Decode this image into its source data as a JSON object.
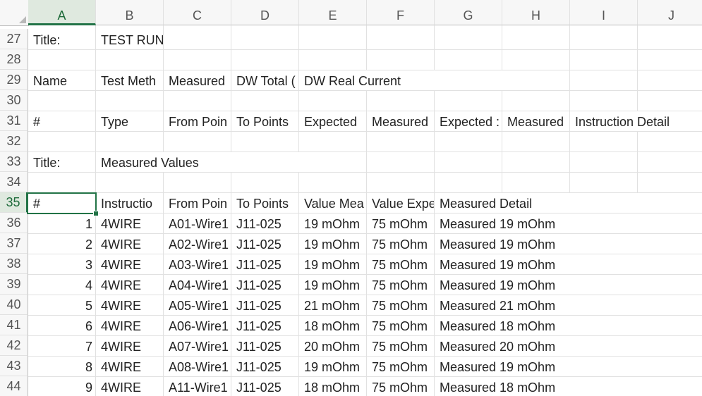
{
  "columns": [
    "A",
    "B",
    "C",
    "D",
    "E",
    "F",
    "G",
    "H",
    "I",
    "J"
  ],
  "selected_column": "A",
  "selected_row": "35",
  "rows": [
    {
      "num": "27",
      "cells": [
        "Title:",
        "TEST RUN",
        "",
        "",
        "",
        "",
        "",
        "",
        "",
        ""
      ]
    },
    {
      "num": "28",
      "cells": [
        "",
        "",
        "",
        "",
        "",
        "",
        "",
        "",
        "",
        ""
      ]
    },
    {
      "num": "29",
      "cells": [
        "Name",
        "Test Meth",
        "Measured",
        "DW Total (",
        "DW Real Current",
        "",
        "",
        "",
        "",
        ""
      ]
    },
    {
      "num": "30",
      "cells": [
        "",
        "",
        "",
        "",
        "",
        "",
        "",
        "",
        "",
        ""
      ]
    },
    {
      "num": "31",
      "cells": [
        "#",
        "Type",
        "From Poin",
        "To Points",
        "Expected",
        "Measured",
        "Expected :",
        "Measured",
        "Instruction Detail",
        ""
      ]
    },
    {
      "num": "32",
      "cells": [
        "",
        "",
        "",
        "",
        "",
        "",
        "",
        "",
        "",
        ""
      ]
    },
    {
      "num": "33",
      "cells": [
        "Title:",
        "Measured Values",
        "",
        "",
        "",
        "",
        "",
        "",
        "",
        ""
      ]
    },
    {
      "num": "34",
      "cells": [
        "",
        "",
        "",
        "",
        "",
        "",
        "",
        "",
        "",
        ""
      ]
    },
    {
      "num": "35",
      "cells": [
        "#",
        "Instructio",
        "From Poin",
        "To Points",
        "Value Mea",
        "Value Expe",
        "Measured Detail",
        "",
        "",
        ""
      ]
    },
    {
      "num": "36",
      "cells": [
        "1",
        "4WIRE",
        "A01-Wire1",
        "J11-025",
        "19 mOhm",
        "75 mOhm",
        "Measured 19 mOhm",
        "",
        "",
        ""
      ]
    },
    {
      "num": "37",
      "cells": [
        "2",
        "4WIRE",
        "A02-Wire1",
        "J11-025",
        "19 mOhm",
        "75 mOhm",
        "Measured 19 mOhm",
        "",
        "",
        ""
      ]
    },
    {
      "num": "38",
      "cells": [
        "3",
        "4WIRE",
        "A03-Wire1",
        "J11-025",
        "19 mOhm",
        "75 mOhm",
        "Measured 19 mOhm",
        "",
        "",
        ""
      ]
    },
    {
      "num": "39",
      "cells": [
        "4",
        "4WIRE",
        "A04-Wire1",
        "J11-025",
        "19 mOhm",
        "75 mOhm",
        "Measured 19 mOhm",
        "",
        "",
        ""
      ]
    },
    {
      "num": "40",
      "cells": [
        "5",
        "4WIRE",
        "A05-Wire1",
        "J11-025",
        "21 mOhm",
        "75 mOhm",
        "Measured 21 mOhm",
        "",
        "",
        ""
      ]
    },
    {
      "num": "41",
      "cells": [
        "6",
        "4WIRE",
        "A06-Wire1",
        "J11-025",
        "18 mOhm",
        "75 mOhm",
        "Measured 18 mOhm",
        "",
        "",
        ""
      ]
    },
    {
      "num": "42",
      "cells": [
        "7",
        "4WIRE",
        "A07-Wire1",
        "J11-025",
        "20 mOhm",
        "75 mOhm",
        "Measured 20 mOhm",
        "",
        "",
        ""
      ]
    },
    {
      "num": "43",
      "cells": [
        "8",
        "4WIRE",
        "A08-Wire1",
        "J11-025",
        "19 mOhm",
        "75 mOhm",
        "Measured 19 mOhm",
        "",
        "",
        ""
      ]
    },
    {
      "num": "44",
      "cells": [
        "9",
        "4WIRE",
        "A11-Wire1",
        "J11-025",
        "18 mOhm",
        "75 mOhm",
        "Measured 18 mOhm",
        "",
        "",
        ""
      ]
    }
  ]
}
